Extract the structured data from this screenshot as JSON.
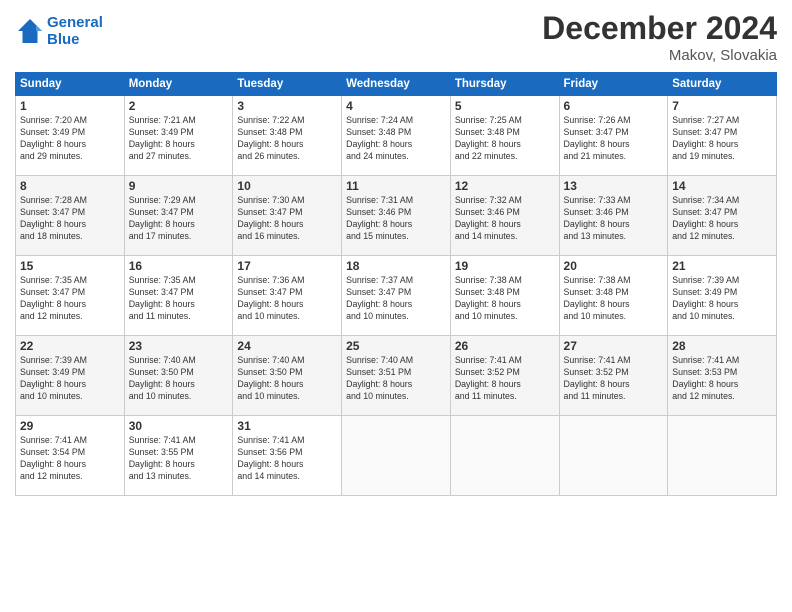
{
  "header": {
    "logo_line1": "General",
    "logo_line2": "Blue",
    "title": "December 2024",
    "location": "Makov, Slovakia"
  },
  "weekdays": [
    "Sunday",
    "Monday",
    "Tuesday",
    "Wednesday",
    "Thursday",
    "Friday",
    "Saturday"
  ],
  "weeks": [
    [
      {
        "day": "1",
        "info": "Sunrise: 7:20 AM\nSunset: 3:49 PM\nDaylight: 8 hours\nand 29 minutes."
      },
      {
        "day": "2",
        "info": "Sunrise: 7:21 AM\nSunset: 3:49 PM\nDaylight: 8 hours\nand 27 minutes."
      },
      {
        "day": "3",
        "info": "Sunrise: 7:22 AM\nSunset: 3:48 PM\nDaylight: 8 hours\nand 26 minutes."
      },
      {
        "day": "4",
        "info": "Sunrise: 7:24 AM\nSunset: 3:48 PM\nDaylight: 8 hours\nand 24 minutes."
      },
      {
        "day": "5",
        "info": "Sunrise: 7:25 AM\nSunset: 3:48 PM\nDaylight: 8 hours\nand 22 minutes."
      },
      {
        "day": "6",
        "info": "Sunrise: 7:26 AM\nSunset: 3:47 PM\nDaylight: 8 hours\nand 21 minutes."
      },
      {
        "day": "7",
        "info": "Sunrise: 7:27 AM\nSunset: 3:47 PM\nDaylight: 8 hours\nand 19 minutes."
      }
    ],
    [
      {
        "day": "8",
        "info": "Sunrise: 7:28 AM\nSunset: 3:47 PM\nDaylight: 8 hours\nand 18 minutes."
      },
      {
        "day": "9",
        "info": "Sunrise: 7:29 AM\nSunset: 3:47 PM\nDaylight: 8 hours\nand 17 minutes."
      },
      {
        "day": "10",
        "info": "Sunrise: 7:30 AM\nSunset: 3:47 PM\nDaylight: 8 hours\nand 16 minutes."
      },
      {
        "day": "11",
        "info": "Sunrise: 7:31 AM\nSunset: 3:46 PM\nDaylight: 8 hours\nand 15 minutes."
      },
      {
        "day": "12",
        "info": "Sunrise: 7:32 AM\nSunset: 3:46 PM\nDaylight: 8 hours\nand 14 minutes."
      },
      {
        "day": "13",
        "info": "Sunrise: 7:33 AM\nSunset: 3:46 PM\nDaylight: 8 hours\nand 13 minutes."
      },
      {
        "day": "14",
        "info": "Sunrise: 7:34 AM\nSunset: 3:47 PM\nDaylight: 8 hours\nand 12 minutes."
      }
    ],
    [
      {
        "day": "15",
        "info": "Sunrise: 7:35 AM\nSunset: 3:47 PM\nDaylight: 8 hours\nand 12 minutes."
      },
      {
        "day": "16",
        "info": "Sunrise: 7:35 AM\nSunset: 3:47 PM\nDaylight: 8 hours\nand 11 minutes."
      },
      {
        "day": "17",
        "info": "Sunrise: 7:36 AM\nSunset: 3:47 PM\nDaylight: 8 hours\nand 10 minutes."
      },
      {
        "day": "18",
        "info": "Sunrise: 7:37 AM\nSunset: 3:47 PM\nDaylight: 8 hours\nand 10 minutes."
      },
      {
        "day": "19",
        "info": "Sunrise: 7:38 AM\nSunset: 3:48 PM\nDaylight: 8 hours\nand 10 minutes."
      },
      {
        "day": "20",
        "info": "Sunrise: 7:38 AM\nSunset: 3:48 PM\nDaylight: 8 hours\nand 10 minutes."
      },
      {
        "day": "21",
        "info": "Sunrise: 7:39 AM\nSunset: 3:49 PM\nDaylight: 8 hours\nand 10 minutes."
      }
    ],
    [
      {
        "day": "22",
        "info": "Sunrise: 7:39 AM\nSunset: 3:49 PM\nDaylight: 8 hours\nand 10 minutes."
      },
      {
        "day": "23",
        "info": "Sunrise: 7:40 AM\nSunset: 3:50 PM\nDaylight: 8 hours\nand 10 minutes."
      },
      {
        "day": "24",
        "info": "Sunrise: 7:40 AM\nSunset: 3:50 PM\nDaylight: 8 hours\nand 10 minutes."
      },
      {
        "day": "25",
        "info": "Sunrise: 7:40 AM\nSunset: 3:51 PM\nDaylight: 8 hours\nand 10 minutes."
      },
      {
        "day": "26",
        "info": "Sunrise: 7:41 AM\nSunset: 3:52 PM\nDaylight: 8 hours\nand 11 minutes."
      },
      {
        "day": "27",
        "info": "Sunrise: 7:41 AM\nSunset: 3:52 PM\nDaylight: 8 hours\nand 11 minutes."
      },
      {
        "day": "28",
        "info": "Sunrise: 7:41 AM\nSunset: 3:53 PM\nDaylight: 8 hours\nand 12 minutes."
      }
    ],
    [
      {
        "day": "29",
        "info": "Sunrise: 7:41 AM\nSunset: 3:54 PM\nDaylight: 8 hours\nand 12 minutes."
      },
      {
        "day": "30",
        "info": "Sunrise: 7:41 AM\nSunset: 3:55 PM\nDaylight: 8 hours\nand 13 minutes."
      },
      {
        "day": "31",
        "info": "Sunrise: 7:41 AM\nSunset: 3:56 PM\nDaylight: 8 hours\nand 14 minutes."
      },
      null,
      null,
      null,
      null
    ]
  ]
}
